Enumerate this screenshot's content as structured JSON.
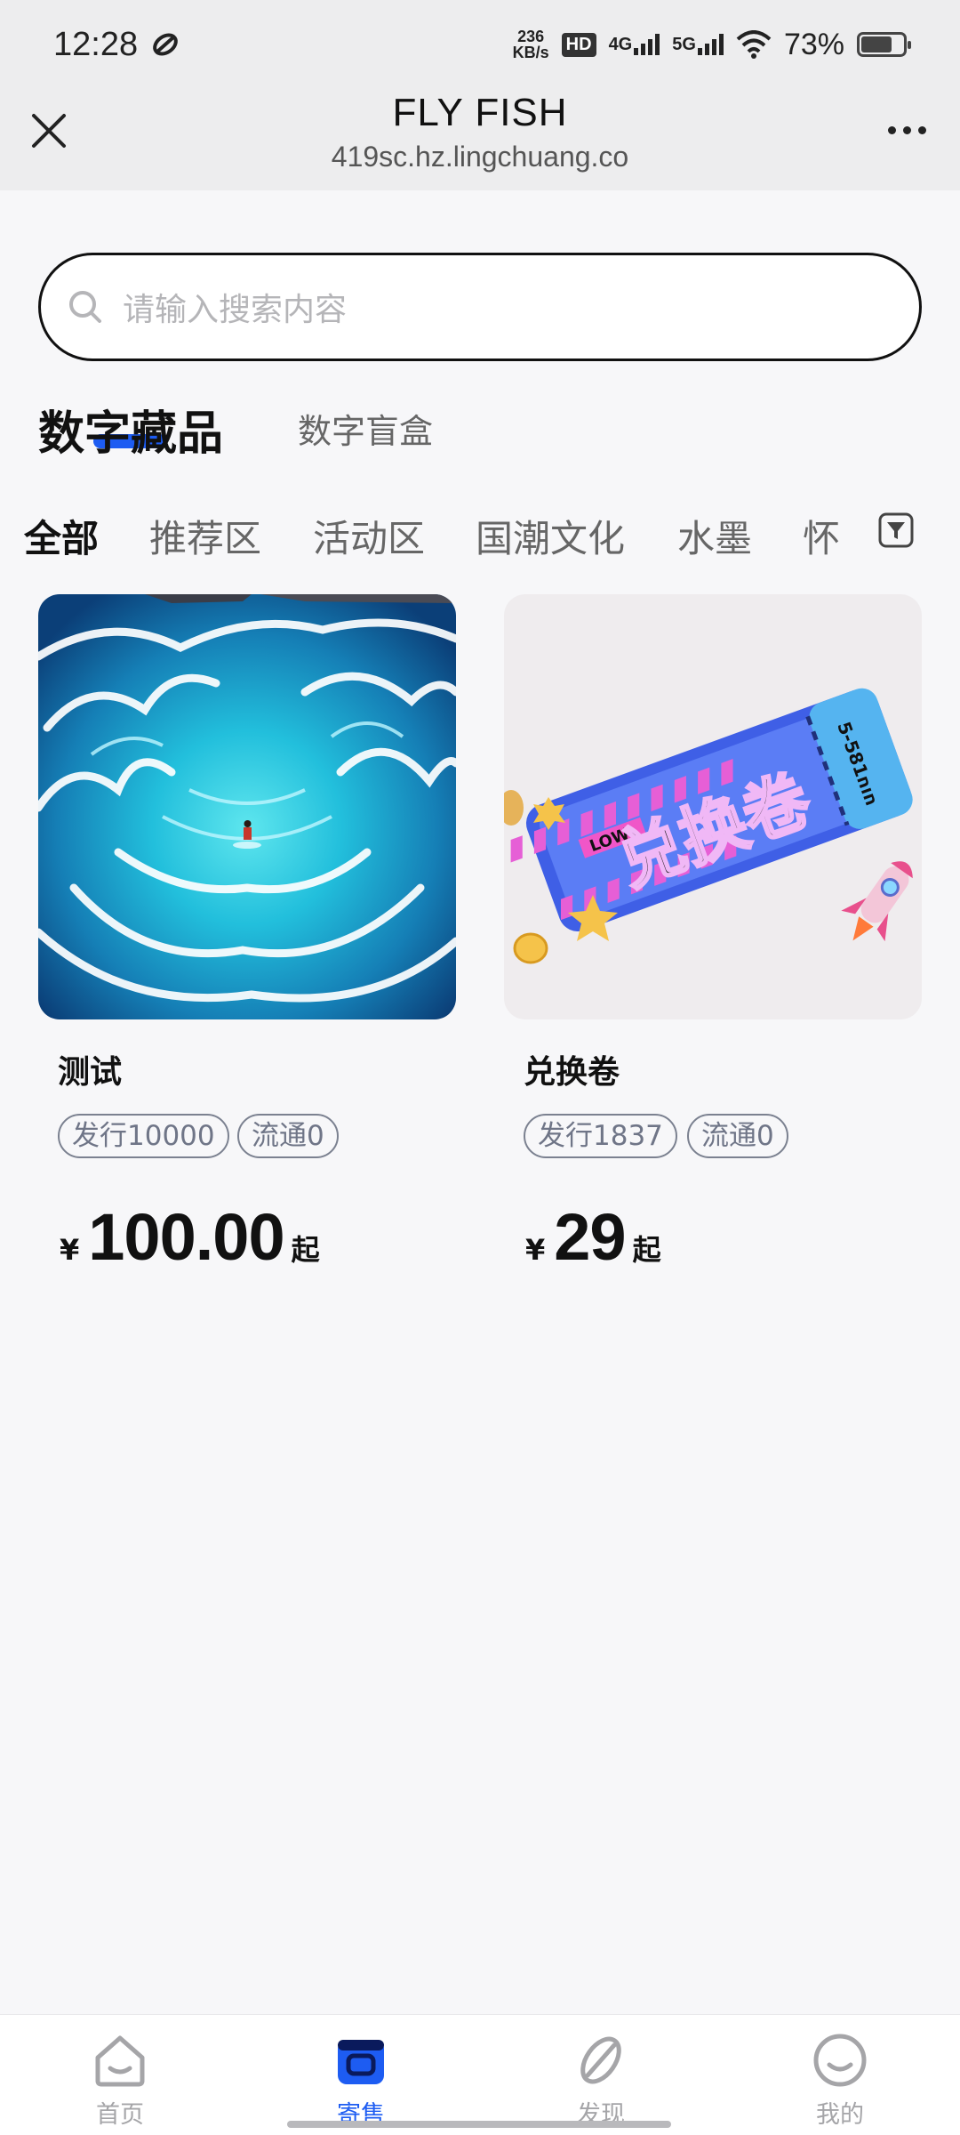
{
  "status_bar": {
    "time": "12:28",
    "net_speed_value": "236",
    "net_speed_unit": "KB/s",
    "hd_badge": "HD",
    "signal_1": "4G",
    "signal_2": "5G",
    "battery_percent": "73%",
    "battery_level": 0.73
  },
  "app_bar": {
    "title": "FLY FISH",
    "url": "419sc.hz.lingchuang.co"
  },
  "search": {
    "placeholder": "请输入搜索内容"
  },
  "main_tabs": [
    {
      "label": "数字藏品",
      "active": true
    },
    {
      "label": "数字盲盒",
      "active": false
    }
  ],
  "categories": [
    {
      "label": "全部",
      "active": true
    },
    {
      "label": "推荐区",
      "active": false
    },
    {
      "label": "活动区",
      "active": false
    },
    {
      "label": "国潮文化",
      "active": false
    },
    {
      "label": "水墨",
      "active": false
    },
    {
      "label": "怀",
      "active": false
    }
  ],
  "products": [
    {
      "name": "测试",
      "issue_tag": "发行10000",
      "circulation_tag": "流通0",
      "price_symbol": "¥",
      "price": "100.00",
      "price_suffix": "起",
      "image": "ocean-waves-illustration"
    },
    {
      "name": "兑换卷",
      "issue_tag": "发行1837",
      "circulation_tag": "流通0",
      "price_symbol": "¥",
      "price": "29",
      "price_suffix": "起",
      "image": "exchange-ticket-illustration",
      "ticket_text": "兑换卷",
      "ticket_badge": "LOW",
      "ticket_code": "5-581חוח"
    }
  ],
  "bottom_nav": [
    {
      "label": "首页",
      "icon": "home-icon",
      "active": false
    },
    {
      "label": "寄售",
      "icon": "consign-icon",
      "active": true
    },
    {
      "label": "发现",
      "icon": "discover-icon",
      "active": false
    },
    {
      "label": "我的",
      "icon": "profile-icon",
      "active": false
    }
  ],
  "colors": {
    "accent": "#1d5cf2",
    "background": "#f7f7f9",
    "tag_border": "#7b8190"
  }
}
